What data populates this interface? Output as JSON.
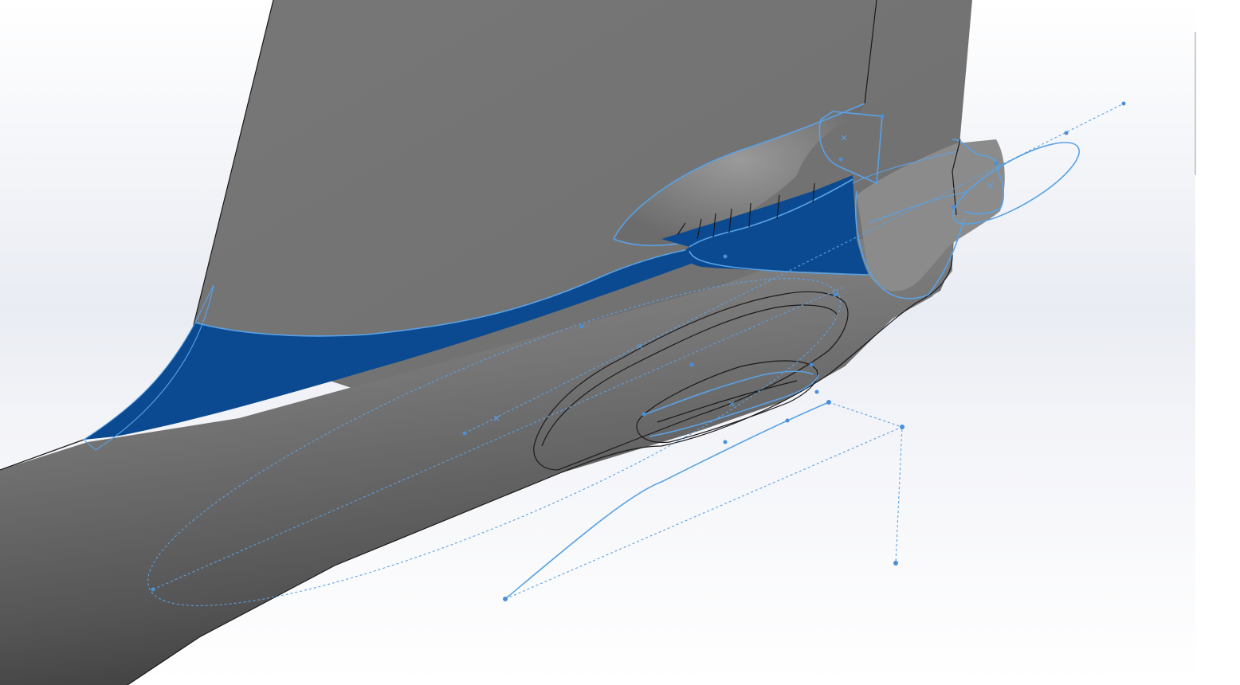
{
  "viewport": {
    "background_color": "#ffffff",
    "part_face_color": "#7b7b7b",
    "selected_face_color": "#0b4a90",
    "sketch_color": "#5aa2e6",
    "edge_color": "#1a1a1a"
  }
}
